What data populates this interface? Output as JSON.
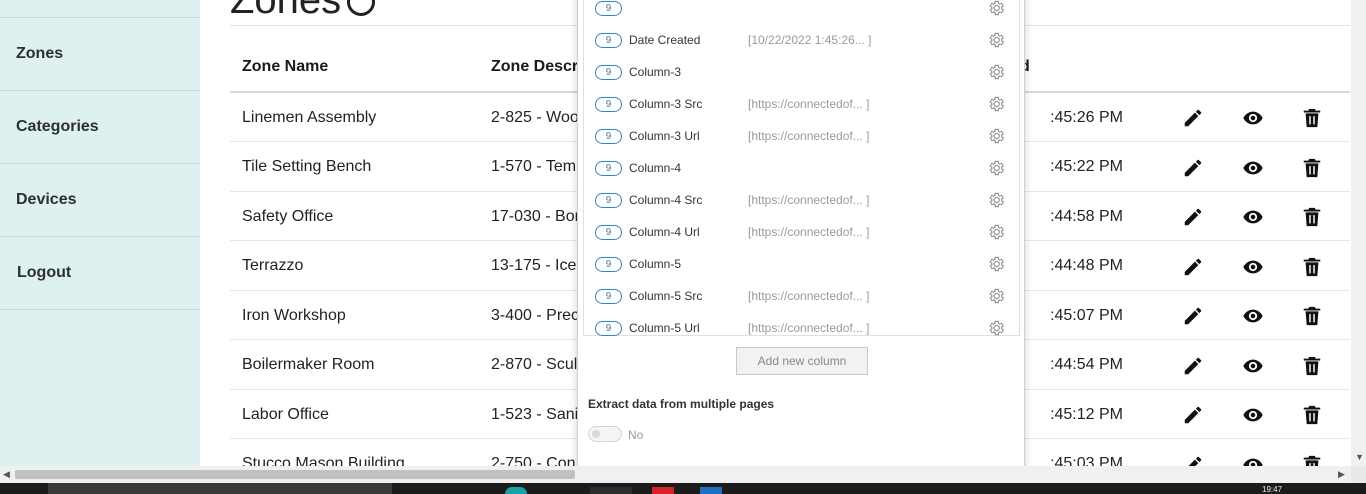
{
  "sidebar": {
    "items": [
      {
        "label": "Zones"
      },
      {
        "label": "Categories"
      },
      {
        "label": "Devices"
      },
      {
        "label": "Logout"
      }
    ]
  },
  "page": {
    "title": "Zones"
  },
  "table": {
    "headers": {
      "zone_name": "Zone Name",
      "zone_description": "Zone Descri",
      "date": "d"
    },
    "rows": [
      {
        "name": "Linemen Assembly",
        "description": "2-825 - Woo",
        "date": ":45:26 PM"
      },
      {
        "name": "Tile Setting Bench",
        "description": "1-570 - Tem",
        "date": ":45:22 PM"
      },
      {
        "name": "Safety Office",
        "description": "17-030 - Bor",
        "date": ":44:58 PM"
      },
      {
        "name": "Terrazzo",
        "description": "13-175 - Ice",
        "date": ":44:48 PM"
      },
      {
        "name": "Iron Workshop",
        "description": "3-400 - Prec",
        "date": ":45:07 PM"
      },
      {
        "name": "Boilermaker Room",
        "description": "2-870 - Scul",
        "date": ":44:54 PM"
      },
      {
        "name": "Labor Office",
        "description": "1-523 - Sani",
        "date": ":45:12 PM"
      },
      {
        "name": "Stucco Mason Building",
        "description": "2-750 - Con",
        "date": ":45:03 PM"
      }
    ],
    "action_icons": [
      "pencil-icon",
      "eye-icon",
      "trash-icon"
    ]
  },
  "popup": {
    "columns": [
      {
        "badge": "9",
        "name": "",
        "preview": ""
      },
      {
        "badge": "9",
        "name": "Date Created",
        "preview": "[10/22/2022 1:45:26... ]"
      },
      {
        "badge": "9",
        "name": "Column-3",
        "preview": ""
      },
      {
        "badge": "9",
        "name": "Column-3 Src",
        "preview": "[https://connectedof... ]"
      },
      {
        "badge": "9",
        "name": "Column-3 Url",
        "preview": "[https://connectedof... ]"
      },
      {
        "badge": "9",
        "name": "Column-4",
        "preview": ""
      },
      {
        "badge": "9",
        "name": "Column-4 Src",
        "preview": "[https://connectedof... ]"
      },
      {
        "badge": "9",
        "name": "Column-4 Url",
        "preview": "[https://connectedof... ]"
      },
      {
        "badge": "9",
        "name": "Column-5",
        "preview": ""
      },
      {
        "badge": "9",
        "name": "Column-5 Src",
        "preview": "[https://connectedof... ]"
      },
      {
        "badge": "9",
        "name": "Column-5 Url",
        "preview": "[https://connectedof... ]"
      }
    ],
    "add_column_label": "Add new column",
    "extract_label": "Extract data from multiple pages",
    "toggle_text": "No"
  },
  "taskbar": {
    "clock": "19:47"
  },
  "colors": {
    "sidebar_bg": "#dff0f0",
    "badge_blue": "#3b7fc4",
    "text_dark": "#222222"
  }
}
